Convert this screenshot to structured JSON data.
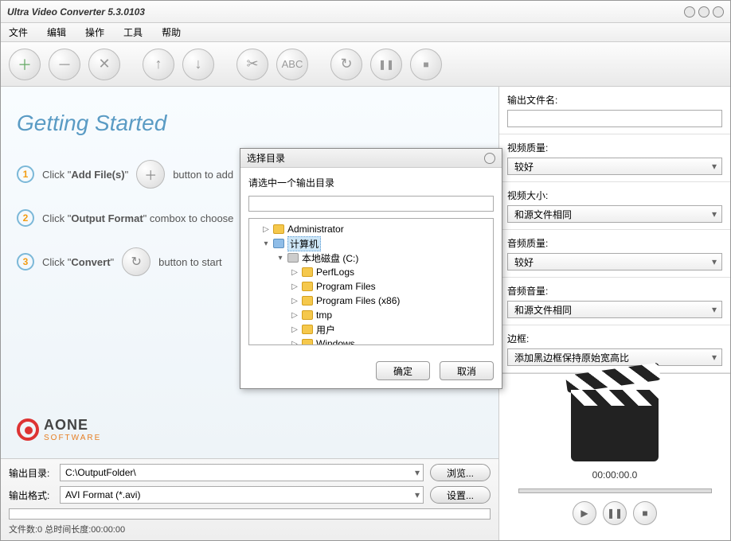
{
  "window": {
    "title": "Ultra Video Converter 5.3.0103"
  },
  "menu": [
    "文件",
    "编辑",
    "操作",
    "工具",
    "帮助"
  ],
  "toolbar_icons": {
    "add": "＋",
    "remove": "－",
    "clear": "✕",
    "up": "↑",
    "down": "↓",
    "cut": "✂",
    "rename": "ABC",
    "convert": "↻",
    "pause": "❚❚",
    "stop": "■"
  },
  "getting_started": {
    "heading": "Getting Started",
    "step1_pre": "Click \"",
    "step1_bold": "Add File(s)",
    "step1_post": "\"",
    "step1_tail": "button to add",
    "step2_pre": "Click \"",
    "step2_bold": "Output Format",
    "step2_post": "\" combox to choose",
    "step3_pre": "Click \"",
    "step3_bold": "Convert",
    "step3_post": "\"",
    "step3_tail": "button to start"
  },
  "brand": {
    "name": "AONE",
    "sub": "SOFTWARE"
  },
  "bottom": {
    "out_dir_label": "输出目录:",
    "out_dir_value": "C:\\OutputFolder\\",
    "out_fmt_label": "输出格式:",
    "out_fmt_value": "AVI Format (*.avi)",
    "browse": "浏览...",
    "settings": "设置...",
    "status": "文件数:0  总时间长度:00:00:00"
  },
  "right": {
    "out_name_label": "输出文件名:",
    "out_name_value": "",
    "video_quality_label": "视频质量:",
    "video_quality_value": "较好",
    "video_size_label": "视频大小:",
    "video_size_value": "和源文件相同",
    "audio_quality_label": "音频质量:",
    "audio_quality_value": "较好",
    "audio_volume_label": "音频音量:",
    "audio_volume_value": "和源文件相同",
    "border_label": "边框:",
    "border_value": "添加黑边框保持原始宽高比"
  },
  "preview": {
    "time": "00:00:00.0"
  },
  "dialog": {
    "title": "选择目录",
    "prompt": "请选中一个输出目录",
    "ok": "确定",
    "cancel": "取消",
    "tree": {
      "admin": "Administrator",
      "computer": "计算机",
      "disk": "本地磁盘 (C:)",
      "children": [
        "PerfLogs",
        "Program Files",
        "Program Files (x86)",
        "tmp",
        "用户",
        "Windows"
      ]
    }
  }
}
